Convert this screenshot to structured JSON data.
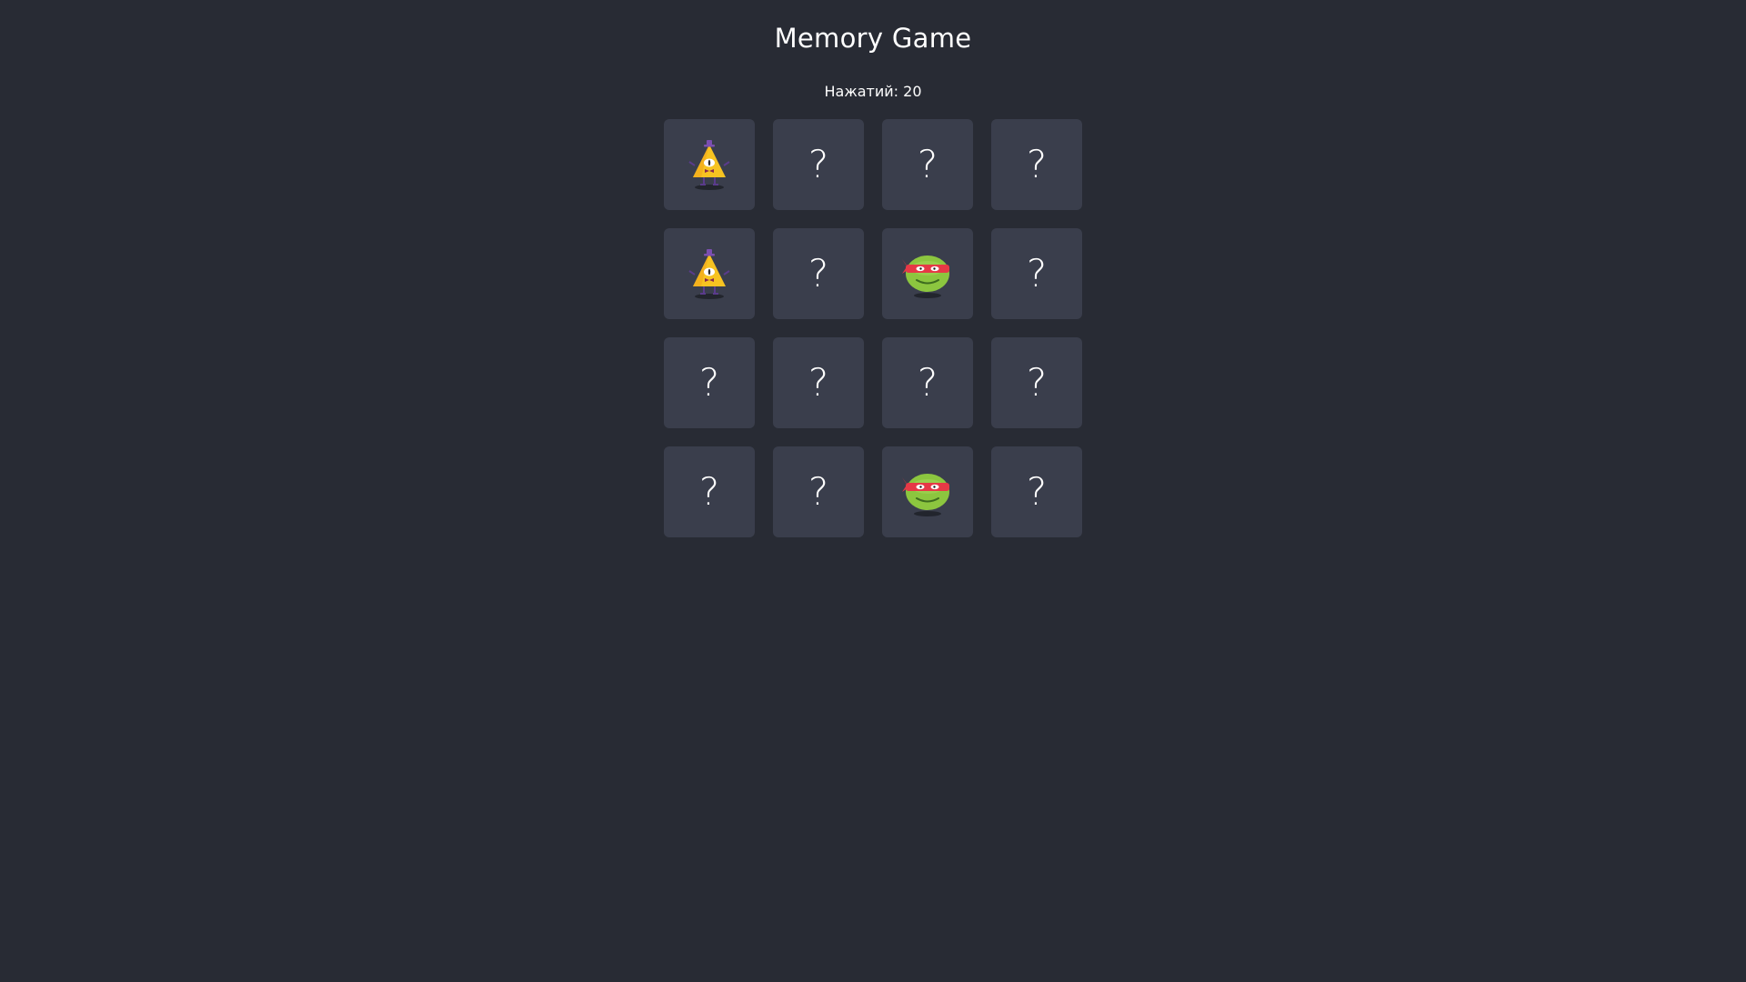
{
  "header": {
    "title": "Memory Game",
    "clicks_text": "Нажатий: 20"
  },
  "colors": {
    "background": "#282b34",
    "card": "#3a3e4c",
    "text": "#ffffff"
  },
  "board": {
    "cards": [
      {
        "face": "bill-cipher-icon",
        "revealed": true
      },
      {
        "face": "?",
        "revealed": false
      },
      {
        "face": "?",
        "revealed": false
      },
      {
        "face": "?",
        "revealed": false
      },
      {
        "face": "bill-cipher-icon",
        "revealed": true
      },
      {
        "face": "?",
        "revealed": false
      },
      {
        "face": "ninja-turtle-icon",
        "revealed": true
      },
      {
        "face": "?",
        "revealed": false
      },
      {
        "face": "?",
        "revealed": false
      },
      {
        "face": "?",
        "revealed": false
      },
      {
        "face": "?",
        "revealed": false
      },
      {
        "face": "?",
        "revealed": false
      },
      {
        "face": "?",
        "revealed": false
      },
      {
        "face": "?",
        "revealed": false
      },
      {
        "face": "ninja-turtle-icon",
        "revealed": true
      },
      {
        "face": "?",
        "revealed": false
      }
    ]
  }
}
